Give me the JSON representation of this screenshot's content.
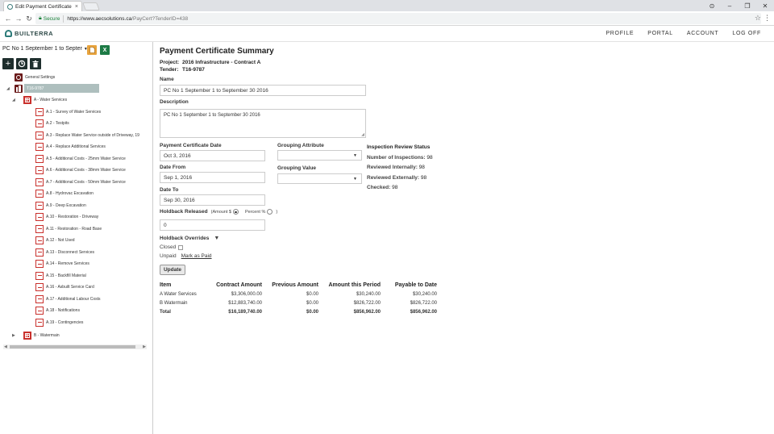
{
  "browser": {
    "tab_title": "Edit Payment Certificate",
    "tab_close": "×",
    "secure_label": "Secure",
    "url_host": "https://www.aecsolutions.ca",
    "url_path": "/PayCert?TenderID=438",
    "controls": {
      "minimize": "–",
      "restore": "❐",
      "close": "✕",
      "account": "⊙"
    }
  },
  "app": {
    "logo_text": "BUILTERRA",
    "nav": [
      "PROFILE",
      "PORTAL",
      "ACCOUNT",
      "LOG OFF"
    ]
  },
  "sidebar": {
    "selected_pc": "PC No 1 September 1 to Septer",
    "xls_label": "X",
    "tree": {
      "settings": "General Settings",
      "project": "T16-9787",
      "group_a": "A - Water Services",
      "items_a": [
        "A.1 - Survey of Water Services",
        "A.2 - Testpits",
        "A.3 - Replace Water Service outside of Driveway, 19",
        "A.4 - Replace Additional Services",
        "A.5 - Additional Costs - 25mm Water Service",
        "A.6 - Additional Costs - 38mm Water Service",
        "A.7 - Additional Costs - 50mm Water Service",
        "A.8 - Hydrovac Excavation",
        "A.9 - Deep Excavation",
        "A.10 - Restoration - Driveway",
        "A.11 - Restoration - Road Base",
        "A.12 - Not Used",
        "A.13 - Disconnect Services",
        "A.14 - Remove Services",
        "A.15 - Backfill Material",
        "A.16 - Asbuilt Service Card",
        "A.17 - Additional Labour Costs",
        "A.18 - Notifications",
        "A.19 - Contingencies"
      ],
      "group_b": "B - Watermain"
    }
  },
  "main": {
    "title": "Payment Certificate Summary",
    "project_label": "Project:",
    "project_value": "2016 Infrastructure - Contract A",
    "tender_label": "Tender:",
    "tender_value": "T16-9787",
    "name_label": "Name",
    "name_value": "PC No 1 September 1 to September 30 2016",
    "description_label": "Description",
    "description_value": "PC No 1 September 1 to September 30 2016",
    "pc_date_label": "Payment Certificate Date",
    "pc_date_value": "Oct 3, 2016",
    "date_from_label": "Date From",
    "date_from_value": "Sep 1, 2016",
    "date_to_label": "Date To",
    "date_to_value": "Sep 30, 2016",
    "grouping_attribute_label": "Grouping Attribute",
    "grouping_value_label": "Grouping Value",
    "holdback_label": "Holdback Released",
    "holdback_amount_label": "(Amount $",
    "holdback_percent_label": "Percent %",
    "holdback_close": ")",
    "holdback_value": "0",
    "holdback_overrides_label": "Holdback Overrides",
    "closed_label": "Closed",
    "unpaid_label": "Unpaid",
    "mark_paid_label": "Mark as Paid",
    "update_label": "Update",
    "inspection": {
      "header": "Inspection Review Status",
      "rows": [
        {
          "label": "Number of Inspections:",
          "value": "98"
        },
        {
          "label": "Reviewed Internally:",
          "value": "98"
        },
        {
          "label": "Reviewed Externally:",
          "value": "98"
        },
        {
          "label": "Checked:",
          "value": "98"
        }
      ]
    },
    "summary": {
      "headers": [
        "Item",
        "Contract Amount",
        "Previous Amount",
        "Amount this Period",
        "Payable to Date"
      ],
      "rows": [
        [
          "A Water Services",
          "$3,306,000.00",
          "$0.00",
          "$30,240.00",
          "$30,240.00"
        ],
        [
          "B Watermain",
          "$12,883,740.00",
          "$0.00",
          "$826,722.00",
          "$826,722.00"
        ]
      ],
      "total": [
        "Total",
        "$16,189,740.00",
        "$0.00",
        "$856,962.00",
        "$856,962.00"
      ]
    }
  }
}
